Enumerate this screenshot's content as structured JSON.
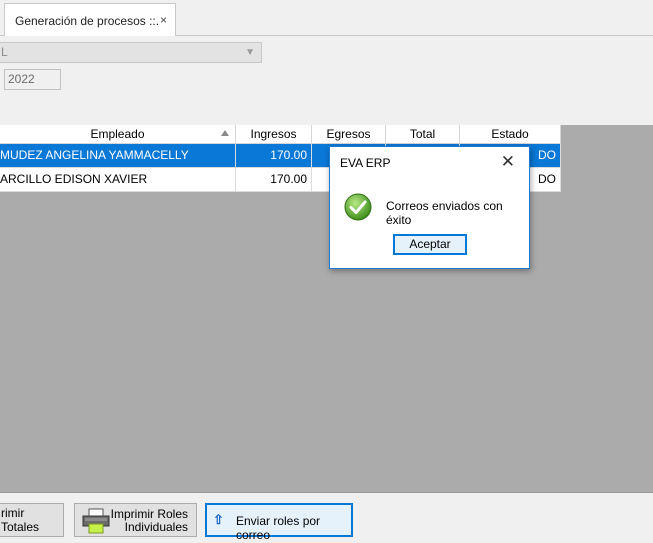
{
  "tab": {
    "label": "Generación de procesos ::.",
    "close": "×"
  },
  "filters": {
    "combo_value": "L",
    "year": "2022"
  },
  "grid": {
    "columns": [
      "Empleado",
      "Ingresos",
      "Egresos",
      "Total",
      "Estado"
    ],
    "rows": [
      {
        "empleado": "MUDEZ ANGELINA YAMMACELLY",
        "ingresos": "170.00",
        "egresos": "",
        "total": "",
        "estado": "DO"
      },
      {
        "empleado": "ARCILLO EDISON XAVIER",
        "ingresos": "170.00",
        "egresos": "",
        "total": "",
        "estado": "DO"
      }
    ]
  },
  "footer": {
    "totales": "rimir Totales",
    "roles_line1": "Imprimir Roles",
    "roles_line2": "Individuales",
    "correo": "Enviar roles por correo"
  },
  "dialog": {
    "title": "EVA ERP",
    "close": "✕",
    "message": "Correos enviados con éxito",
    "ok": "Aceptar"
  },
  "colors": {
    "selection": "#0a78d7",
    "accent": "#0078d7",
    "grid_background": "#ababab"
  }
}
